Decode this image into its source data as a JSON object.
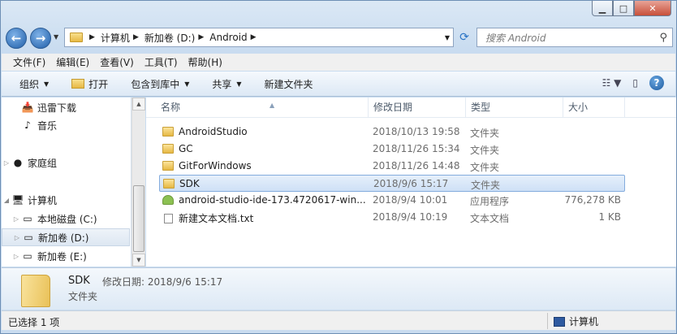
{
  "address": {
    "crumbs": [
      "计算机",
      "新加卷 (D:)",
      "Android"
    ]
  },
  "search": {
    "placeholder": "搜索 Android"
  },
  "menu": [
    "文件(F)",
    "编辑(E)",
    "查看(V)",
    "工具(T)",
    "帮助(H)"
  ],
  "toolbar": {
    "organize": "组织",
    "open": "打开",
    "include": "包含到库中",
    "share": "共享",
    "new_folder": "新建文件夹"
  },
  "nav": {
    "items": [
      {
        "label": "迅雷下载",
        "icon": "download-icon"
      },
      {
        "label": "音乐",
        "icon": "music-icon"
      },
      {
        "label": "家庭组",
        "icon": "homegroup-icon"
      },
      {
        "label": "计算机",
        "icon": "computer-icon"
      },
      {
        "label": "本地磁盘 (C:)",
        "icon": "drive-icon"
      },
      {
        "label": "新加卷 (D:)",
        "icon": "drive-icon"
      },
      {
        "label": "新加卷 (E:)",
        "icon": "drive-icon"
      }
    ]
  },
  "columns": {
    "name": "名称",
    "date": "修改日期",
    "type": "类型",
    "size": "大小"
  },
  "files": [
    {
      "name": "AndroidStudio",
      "date": "2018/10/13 19:58",
      "type": "文件夹",
      "size": "",
      "icon": "folder-icon"
    },
    {
      "name": "GC",
      "date": "2018/11/26 15:34",
      "type": "文件夹",
      "size": "",
      "icon": "folder-icon"
    },
    {
      "name": "GitForWindows",
      "date": "2018/11/26 14:48",
      "type": "文件夹",
      "size": "",
      "icon": "folder-icon"
    },
    {
      "name": "SDK",
      "date": "2018/9/6 15:17",
      "type": "文件夹",
      "size": "",
      "icon": "folder-icon"
    },
    {
      "name": "android-studio-ide-173.4720617-win...",
      "date": "2018/9/4 10:01",
      "type": "应用程序",
      "size": "776,278 KB",
      "icon": "android-app-icon"
    },
    {
      "name": "新建文本文档.txt",
      "date": "2018/9/4 10:19",
      "type": "文本文档",
      "size": "1 KB",
      "icon": "text-file-icon"
    }
  ],
  "details": {
    "name": "SDK",
    "modified": "修改日期: 2018/9/6 15:17",
    "type": "文件夹"
  },
  "status": {
    "selected": "已选择 1 项",
    "location": "计算机"
  }
}
